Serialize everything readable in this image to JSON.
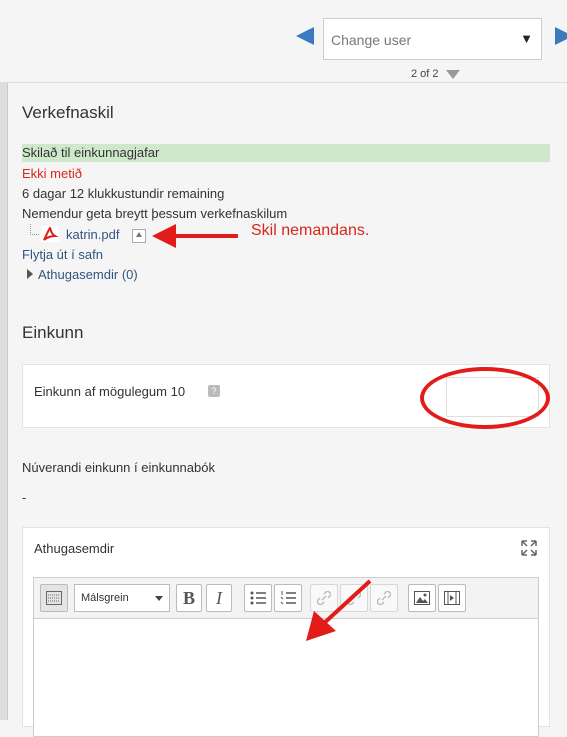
{
  "nav": {
    "user_placeholder": "Change user",
    "count": "2 of 2"
  },
  "submission": {
    "title": "Verkefnaskil",
    "status": "Skilað til einkunnagjafar",
    "grading_status": "Ekki metið",
    "time_remaining": "6 dagar 12 klukkustundir remaining",
    "editable_note": "Nemendur geta breytt þessum verkefnaskilum",
    "file_name": "katrin.pdf",
    "export_link": "Flytja út í safn",
    "comments_link": "Athugasemdir (0)"
  },
  "annotation": {
    "label": "Skil nemandans."
  },
  "grade": {
    "title": "Einkunn",
    "label": "Einkunn af mögulegum 10",
    "help": "?",
    "current_label": "Núverandi einkunn í einkunnabók",
    "current_value": "-"
  },
  "feedback": {
    "title": "Athugasemdir",
    "paragraph_select": "Málsgrein",
    "bold": "B",
    "italic": "I"
  },
  "colors": {
    "accent_blue": "#3a7bbf",
    "status_green": "#cfe8cc",
    "annotation_red": "#e21b1b"
  }
}
